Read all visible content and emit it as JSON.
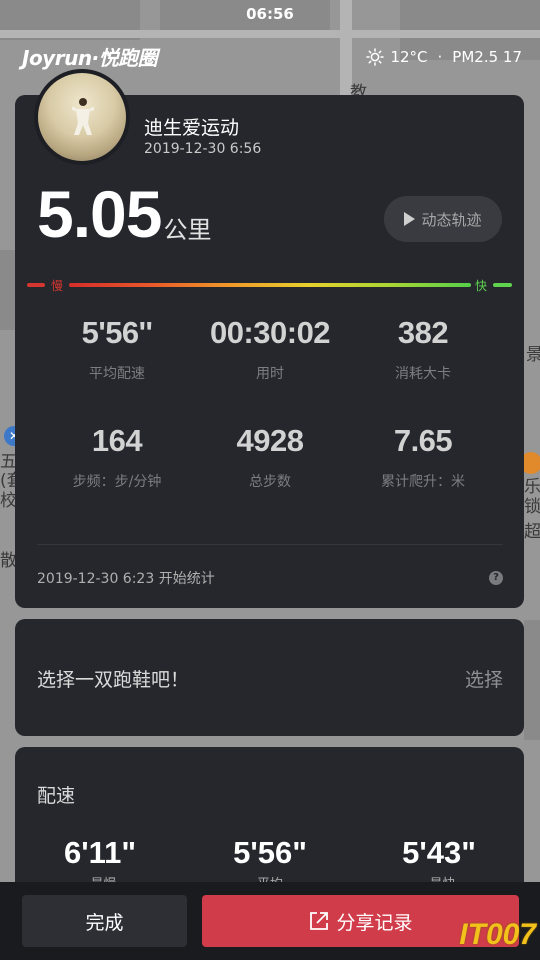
{
  "status_bar": {
    "time": "06:56"
  },
  "header": {
    "brand": "Joyrun·悦跑圈",
    "weather": {
      "temperature": "12°C",
      "separator": "·",
      "air_quality": "PM2.5 17",
      "icon": "sun-icon"
    }
  },
  "map": {
    "labels": [
      "教",
      "景",
      "五",
      "(套",
      "校",
      "散步",
      "乐",
      "锁超"
    ]
  },
  "run": {
    "user_name": "迪生爱运动",
    "timestamp": "2019-12-30 6:56",
    "distance": "5.05",
    "distance_unit": "公里",
    "track_button": "动态轨迹",
    "pace_scale": {
      "slow": "慢",
      "fast": "快"
    },
    "stats": [
      {
        "value": "5'56''",
        "label": "平均配速"
      },
      {
        "value": "00:30:02",
        "label": "用时"
      },
      {
        "value": "382",
        "label": "消耗大卡"
      },
      {
        "value": "164",
        "label": "步频：步/分钟"
      },
      {
        "value": "4928",
        "label": "总步数"
      },
      {
        "value": "7.65",
        "label": "累计爬升：米"
      }
    ],
    "start_note": "2019-12-30 6:23 开始统计",
    "help_icon": "?"
  },
  "shoes": {
    "prompt": "选择一双跑鞋吧！",
    "select_label": "选择"
  },
  "pace_section": {
    "title": "配速",
    "items": [
      {
        "value": "6'11\"",
        "label": "最慢",
        "dot_color": "#d5362f"
      },
      {
        "value": "5'56\"",
        "label": "平均",
        "dot_color": ""
      },
      {
        "value": "5'43\"",
        "label": "最快",
        "dot_color": "#5fd24e"
      }
    ]
  },
  "actions": {
    "done": "完成",
    "share": "分享记录",
    "share_icon": "share-icon"
  },
  "watermark": "IT007"
}
